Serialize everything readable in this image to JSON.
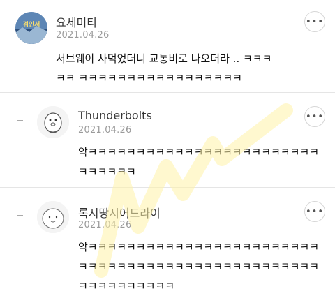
{
  "comments": [
    {
      "username": "요세미티",
      "date": "2021.04.26",
      "text": "서브웨이 사먹었더니 교통비로 나오더라 .. ㅋㅋㅋㅋㅋ ㅋㅋㅋㅋㅋㅋㅋㅋㅋㅋㅋㅋㅋㅋㅋㅋㅋ",
      "avatar_icon": "game-banner-avatar-icon",
      "avatar_text": "검인서"
    },
    {
      "username": "Thunderbolts",
      "date": "2021.04.26",
      "text": "악ㅋㅋㅋㅋㅋㅋㅋㅋㅋㅋㅋㅋㅋㅋㅋㅋㅋㅋㅋㅋㅋㅋㅋㅋㅋㅋㅋㅋㅋㅋ",
      "avatar_icon": "sketch-character-avatar-icon"
    },
    {
      "username": "록시땅시어드라이",
      "date": "2021.04.26",
      "text": "악ㅋㅋㅋㅋㅋㅋㅋㅋㅋㅋㅋㅋㅋㅋㅋㅋㅋㅋㅋㅋㅋㅋㅋㅋㅋㅋㅋㅋㅋㅋㅋㅋㅋㅋㅋㅋㅋㅋㅋㅋㅋㅋㅋㅋㅋㅋㅋㅋㅋㅋㅋㅋㅋㅋㅋㅋㅋㅋㅋ",
      "avatar_icon": "round-face-avatar-icon"
    }
  ],
  "more_label": "•••",
  "colors": {
    "watermark": "#fff3a8",
    "divider": "#e5e5e5",
    "date": "#9a9a9a"
  }
}
